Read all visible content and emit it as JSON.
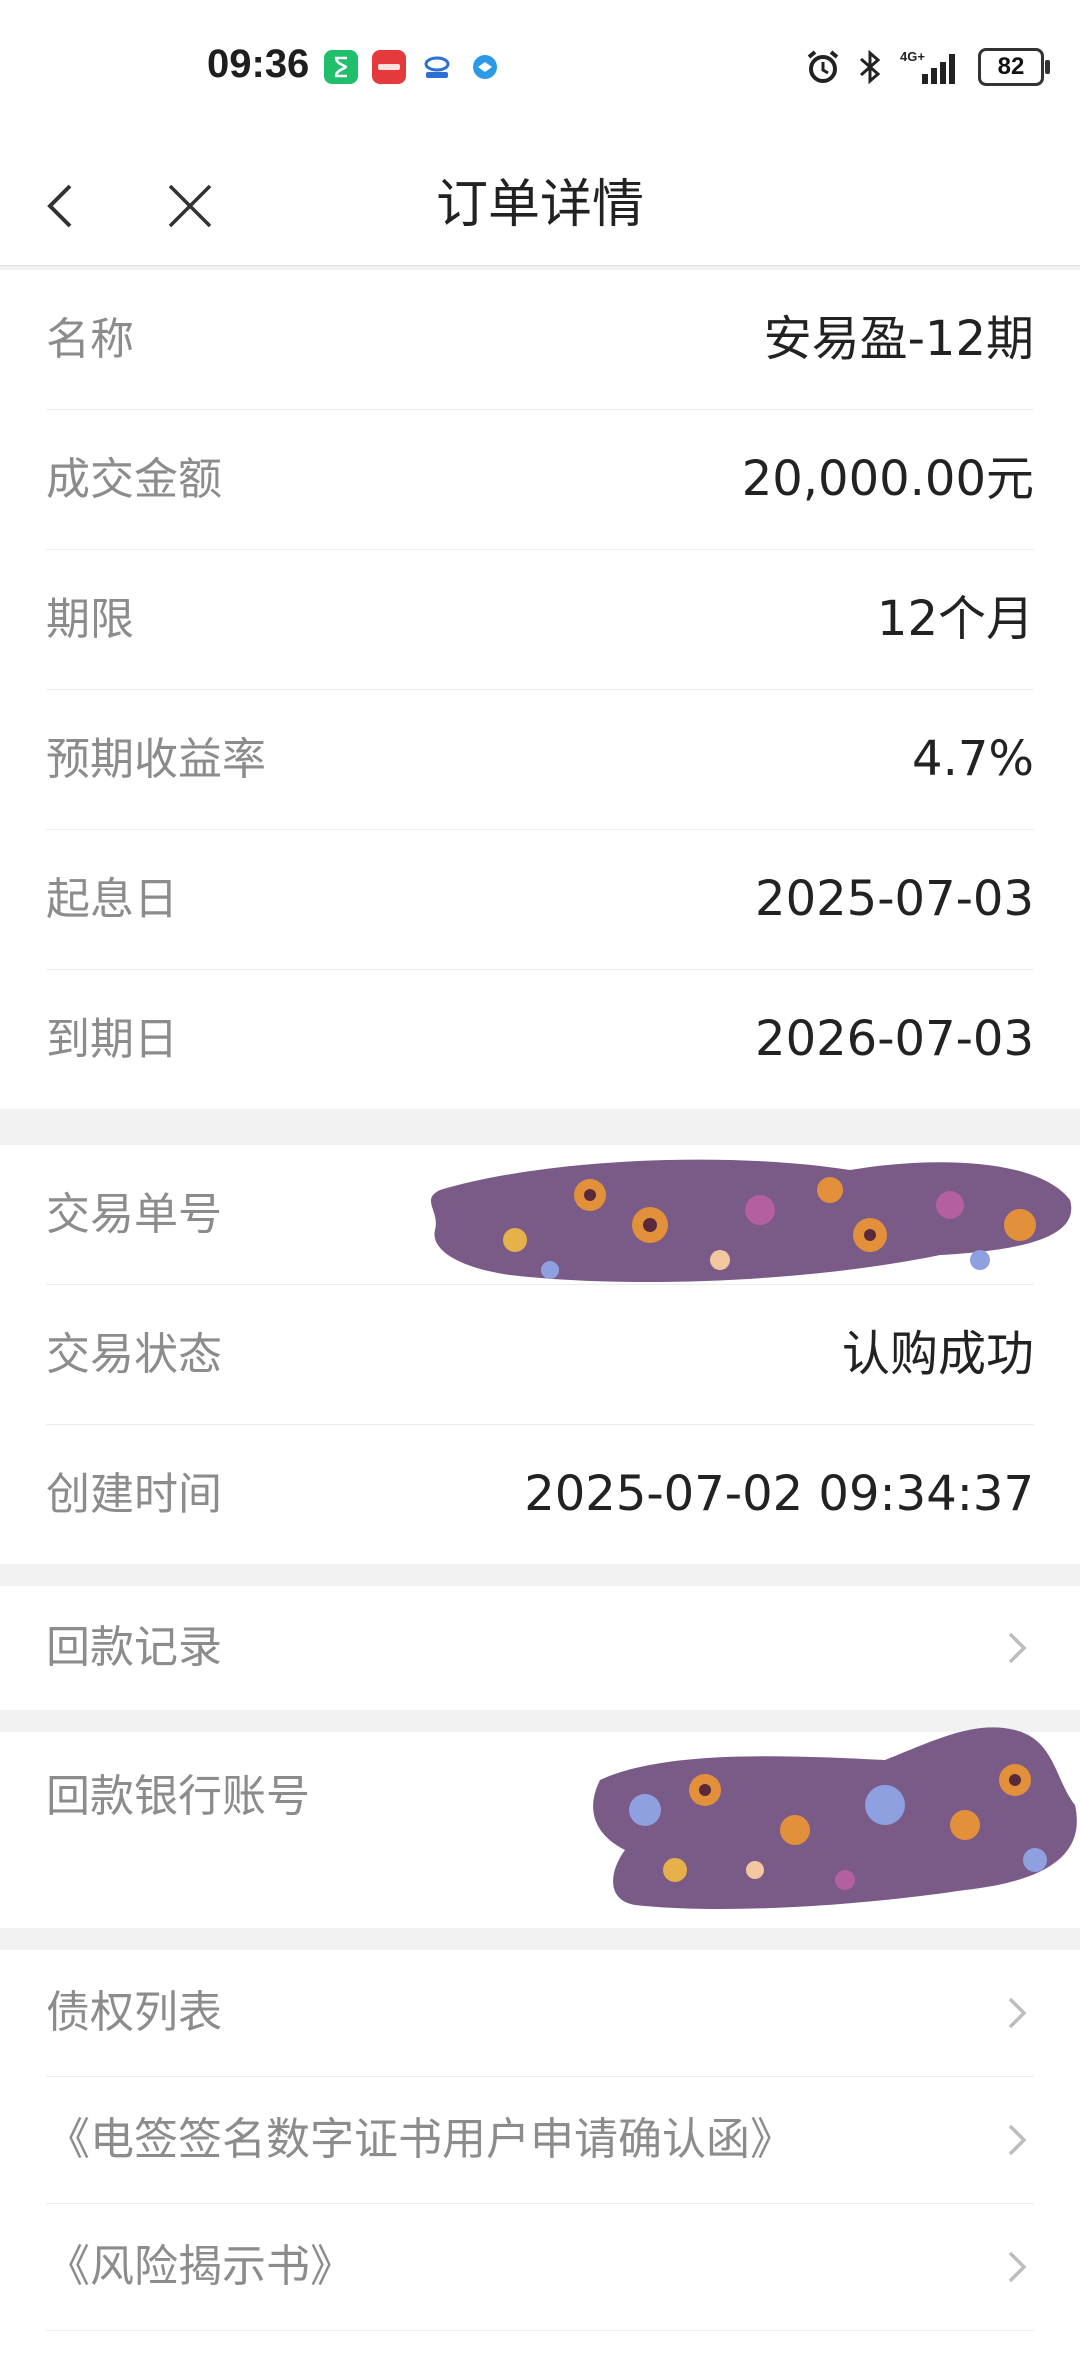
{
  "status_bar": {
    "time": "09:36",
    "battery": "82",
    "icons": [
      "hourglass-icon",
      "huawei-icon",
      "app-icon",
      "browser-icon",
      "alarm-icon",
      "bluetooth-icon",
      "signal-4g-icon",
      "battery-icon"
    ]
  },
  "nav": {
    "title": "订单详情",
    "back_icon": "chevron-left-icon",
    "close_icon": "close-icon"
  },
  "details": [
    {
      "label": "名称",
      "value": "安易盈-12期"
    },
    {
      "label": "成交金额",
      "value": "20,000.00元"
    },
    {
      "label": "期限",
      "value": "12个月"
    },
    {
      "label": "预期收益率",
      "value": "4.7%"
    },
    {
      "label": "起息日",
      "value": "2025-07-03"
    },
    {
      "label": "到期日",
      "value": "2026-07-03"
    }
  ],
  "trade": [
    {
      "label": "交易单号",
      "value": ""
    },
    {
      "label": "交易状态",
      "value": "认购成功"
    },
    {
      "label": "创建时间",
      "value": "2025-07-02 09:34:37"
    }
  ],
  "repayment_record": {
    "label": "回款记录"
  },
  "repayment_account": {
    "label": "回款银行账号"
  },
  "documents": [
    {
      "label": "债权列表"
    },
    {
      "label": "《电签签名数字证书用户申请确认函》"
    },
    {
      "label": "《风险揭示书》"
    }
  ],
  "colors": {
    "background": "#f2f2f2",
    "card": "#ffffff",
    "label_gray": "#8c8c8c",
    "redaction_purple": "#7a5a86"
  }
}
